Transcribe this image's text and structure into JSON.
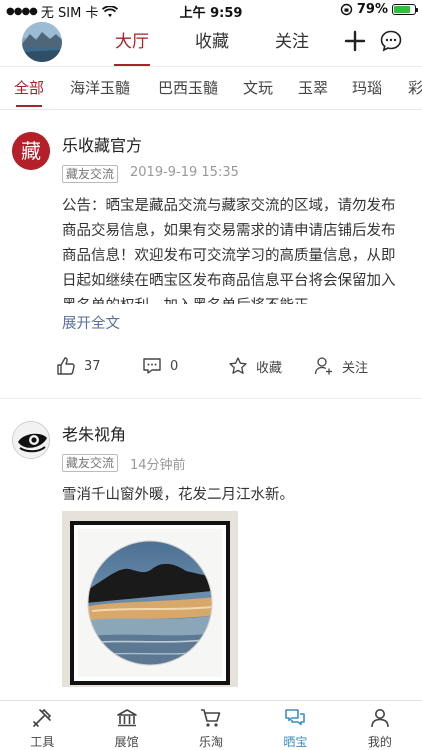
{
  "status_bar": {
    "carrier": "无 SIM 卡",
    "time": "上午 9:59",
    "battery": "79%",
    "battery_level": 0.79
  },
  "top_nav": {
    "tabs": [
      {
        "label": "大厅",
        "active": true
      },
      {
        "label": "收藏",
        "active": false
      },
      {
        "label": "关注",
        "active": false
      }
    ],
    "icons": [
      "plus-icon",
      "chat-bubble-icon"
    ]
  },
  "categories": [
    {
      "label": "全部",
      "active": true
    },
    {
      "label": "海洋玉髓",
      "active": false
    },
    {
      "label": "巴西玉髓",
      "active": false
    },
    {
      "label": "文玩",
      "active": false
    },
    {
      "label": "玉翠",
      "active": false
    },
    {
      "label": "玛瑙",
      "active": false
    },
    {
      "label": "彩",
      "active": false
    }
  ],
  "posts": [
    {
      "author": "乐收藏官方",
      "avatar_glyph": "藏",
      "tag": "藏友交流",
      "time": "2019-9-19 15:35",
      "text": "公告：晒宝是藏品交流与藏家交流的区域，请勿发布商品交易信息，如果有交易需求的请申请店铺后发布商品信息！欢迎发布可交流学习的高质量信息，从即日起如继续在晒宝区发布商品信息平台将会保留加入黑名单的权利，加入黑名单后将不能正",
      "expand": "展开全文",
      "likes": "37",
      "comments": "0",
      "favorite": "收藏",
      "follow": "关注"
    },
    {
      "author": "老朱视角",
      "tag": "藏友交流",
      "time": "14分钟前",
      "text": "雪消千山窗外暖，花发二月江水新。"
    }
  ],
  "tabbar": [
    {
      "label": "工具",
      "icon": "tools-icon",
      "active": false
    },
    {
      "label": "展馆",
      "icon": "museum-icon",
      "active": false
    },
    {
      "label": "乐淘",
      "icon": "cart-icon",
      "active": false
    },
    {
      "label": "晒宝",
      "icon": "chat-bubbles-icon",
      "active": true
    },
    {
      "label": "我的",
      "icon": "user-icon",
      "active": false
    }
  ],
  "colors": {
    "accent": "#a8232b",
    "tab_active": "#3a8fc4",
    "link": "#5a6fa0"
  }
}
